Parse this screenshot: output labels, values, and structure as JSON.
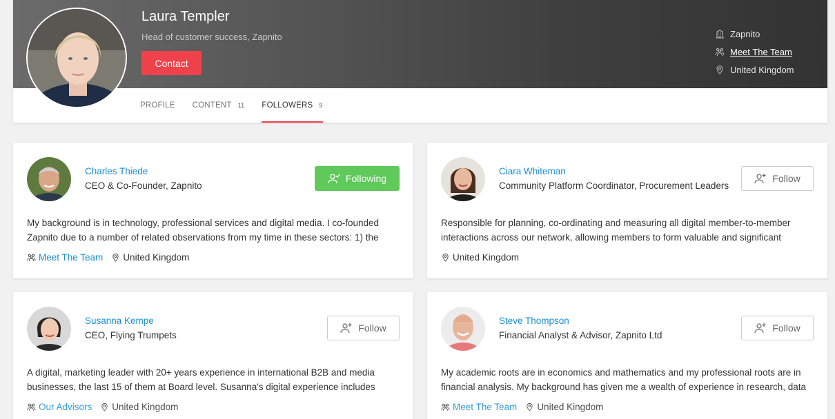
{
  "profile": {
    "name": "Laura Templer",
    "role": "Head of customer success, Zapnito",
    "contact_label": "Contact",
    "company": "Zapnito",
    "team": "Meet The Team",
    "location": "United Kingdom"
  },
  "tabs": [
    {
      "label": "PROFILE",
      "count": ""
    },
    {
      "label": "CONTENT",
      "count": "11"
    },
    {
      "label": "FOLLOWERS",
      "count": "9",
      "active": true
    }
  ],
  "followers": [
    {
      "name": "Charles Thiede",
      "title": "CEO & Co-Founder, Zapnito",
      "bio": "My background is in technology, professional services and digital media. I co-founded Zapnito due to a number of related observations from my time in these sectors: 1) the",
      "team": "Meet The Team",
      "country": "United Kingdom",
      "button": "Following"
    },
    {
      "name": "Ciara Whiteman",
      "title": "Community Platform Coordinator, Procurement Leaders",
      "bio": "Responsible for planning, co-ordinating and measuring all digital member-to-member interactions across our network, allowing members to form valuable and significant",
      "team": "",
      "country": "United Kingdom",
      "button": "Follow"
    },
    {
      "name": "Susanna Kempe",
      "title": "CEO, Flying Trumpets",
      "bio": "A digital, marketing leader with 20+ years experience in international B2B and media businesses, the last 15 of them at Board level. Susanna's digital experience includes being",
      "team": "Our Advisors",
      "country": "United Kingdom",
      "button": "Follow"
    },
    {
      "name": "Steve Thompson",
      "title": "Financial Analyst & Advisor, Zapnito Ltd",
      "bio": "My academic roots are in economics and mathematics and my professional roots are in financial analysis. My background has given me a wealth of experience in research, data",
      "team": "Meet The Team",
      "country": "United Kingdom",
      "button": "Follow"
    }
  ],
  "colors": {
    "accent": "#f0424a",
    "link": "#1a8fd1",
    "following": "#5fc95a"
  }
}
